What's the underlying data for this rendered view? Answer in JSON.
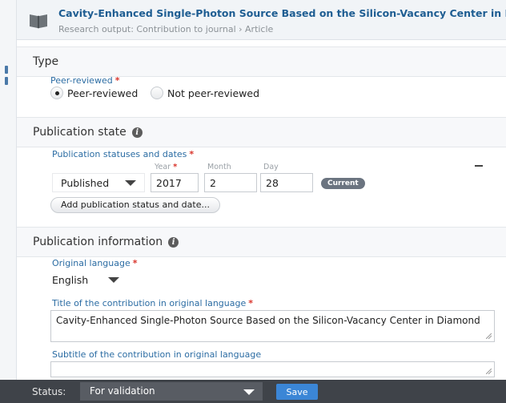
{
  "header": {
    "title": "Cavity-Enhanced Single-Photon Source Based on the Silicon-Vacancy Center in Diamond",
    "subtitle": "Research output: Contribution to journal › Article",
    "icon": "book-icon"
  },
  "type_section": {
    "title": "Type",
    "peer_label": "Peer-reviewed",
    "required_mark": "*",
    "options": [
      "Peer-reviewed",
      "Not peer-reviewed"
    ],
    "selected": "Peer-reviewed"
  },
  "publication_state": {
    "title": "Publication state",
    "statuses_label": "Publication statuses and dates",
    "status_value": "Published",
    "year_label": "Year",
    "month_label": "Month",
    "day_label": "Day",
    "year": "2017",
    "month": "2",
    "day": "28",
    "badge": "Current",
    "add_button": "Add publication status and date..."
  },
  "publication_info": {
    "title": "Publication information",
    "language_label": "Original language",
    "language_value": "English",
    "title_label": "Title of the contribution in original language",
    "title_value": "Cavity-Enhanced Single-Photon Source Based on the Silicon-Vacancy Center in Diamond",
    "subtitle_label": "Subtitle of the contribution in original language",
    "subtitle_value": ""
  },
  "footer": {
    "status_label": "Status:",
    "status_value": "For validation",
    "save_label": "Save"
  },
  "colors": {
    "link_blue": "#2b6ca3",
    "title_blue": "#1e5d92",
    "required_red": "#d9342b",
    "footer_bg": "#3f4349",
    "save_blue": "#3b86d6"
  }
}
